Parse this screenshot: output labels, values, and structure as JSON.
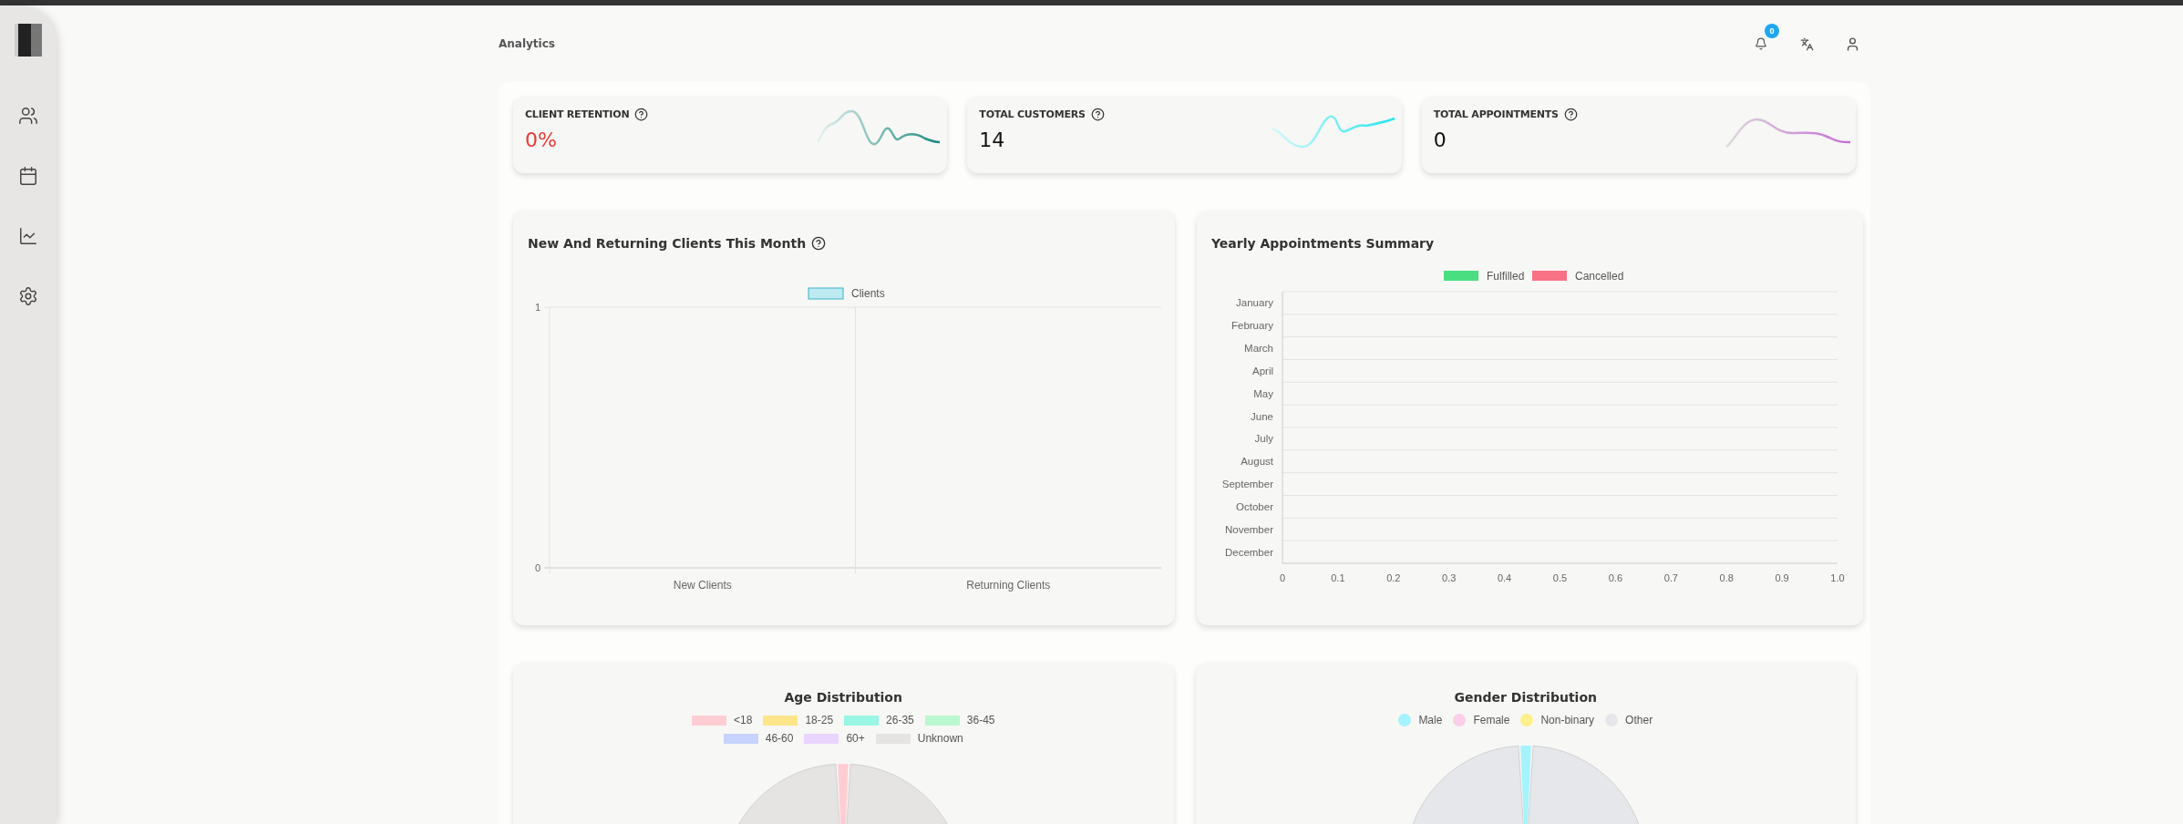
{
  "header": {
    "title": "Analytics",
    "notifications": "0"
  },
  "stats": [
    {
      "label": "CLIENT RETENTION",
      "value": "0%",
      "color": "#e53935",
      "help_icon": true
    },
    {
      "label": "TOTAL CUSTOMERS",
      "value": "14",
      "color": "#111111",
      "help_icon": true
    },
    {
      "label": "TOTAL APPOINTMENTS",
      "value": "0",
      "color": "#111111",
      "help_icon": true
    }
  ],
  "charts": [
    {
      "title": "New And Returning Clients This Month",
      "help_icon": true,
      "chart_data": {
        "type": "bar",
        "categories": [
          "New Clients",
          "Returning Clients"
        ],
        "series": [
          {
            "name": "Clients",
            "color": "#36b6c9",
            "values": [
              0,
              0
            ]
          }
        ],
        "ylim": [
          0,
          1
        ],
        "yticks": [
          0,
          1
        ]
      }
    },
    {
      "title": "Yearly Appointments Summary",
      "help_icon": false,
      "chart_data": {
        "type": "bar",
        "orientation": "horizontal",
        "categories": [
          "January",
          "February",
          "March",
          "April",
          "May",
          "June",
          "July",
          "August",
          "September",
          "October",
          "November",
          "December"
        ],
        "series": [
          {
            "name": "Fulfilled",
            "color": "#4ade80",
            "values": [
              0,
              0,
              0,
              0,
              0,
              0,
              0,
              0,
              0,
              0,
              0,
              0
            ]
          },
          {
            "name": "Cancelled",
            "color": "#f87185",
            "values": [
              0,
              0,
              0,
              0,
              0,
              0,
              0,
              0,
              0,
              0,
              0,
              0
            ]
          }
        ],
        "xlim": [
          0,
          1
        ],
        "xticks": [
          0,
          0.1,
          0.2,
          0.3,
          0.4,
          0.5,
          0.6,
          0.7,
          0.8,
          0.9,
          {
            "value": 1,
            "label": "1.0"
          }
        ]
      }
    }
  ],
  "distributions": [
    {
      "title": "Age Distribution",
      "kind": "box",
      "legend": [
        {
          "label": "<18",
          "color": "#fecdd3"
        },
        {
          "label": "18-25",
          "color": "#fde68a"
        },
        {
          "label": "26-35",
          "color": "#99f6e4"
        },
        {
          "label": "36-45",
          "color": "#bbf7d0"
        },
        {
          "label": "46-60",
          "color": "#c7d2fe"
        },
        {
          "label": "60+",
          "color": "#e9d5ff"
        },
        {
          "label": "Unknown",
          "color": "#e5e4e2"
        }
      ]
    },
    {
      "title": "Gender Distribution",
      "kind": "dot",
      "legend": [
        {
          "label": "Male",
          "color": "#a5f3fc"
        },
        {
          "label": "Female",
          "color": "#fbcfe8"
        },
        {
          "label": "Non-binary",
          "color": "#fef08a"
        },
        {
          "label": "Other",
          "color": "#e5e7eb"
        }
      ]
    }
  ]
}
